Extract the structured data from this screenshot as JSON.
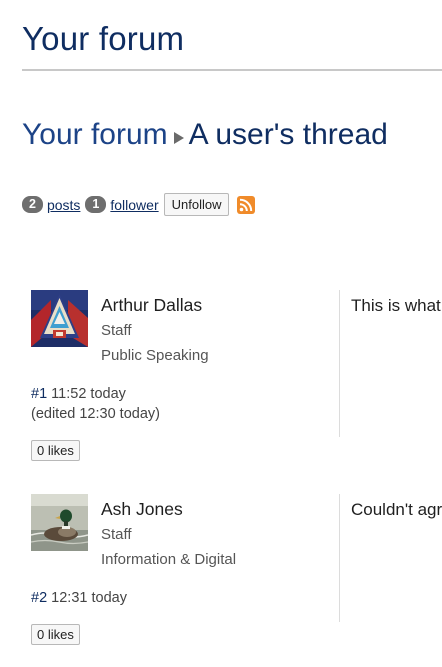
{
  "site": {
    "title": "Your forum"
  },
  "breadcrumb": {
    "forum": "Your forum",
    "thread": "A user's thread"
  },
  "stats": {
    "posts_count": "2",
    "posts_label": "posts",
    "followers_count": "1",
    "followers_label": "follower",
    "unfollow_label": "Unfollow",
    "rss_icon": "rss-feed-icon"
  },
  "posts": [
    {
      "author": "Arthur Dallas",
      "role": "Staff",
      "team": "Public Speaking",
      "number": "#1",
      "time": "11:52 today",
      "edited": "(edited 12:30 today)",
      "likes": "0 likes",
      "content": "This is what"
    },
    {
      "author": "Ash Jones",
      "role": "Staff",
      "team": "Information & Digital",
      "number": "#2",
      "time": "12:31 today",
      "likes": "0 likes",
      "content": "Couldn't agr"
    }
  ]
}
